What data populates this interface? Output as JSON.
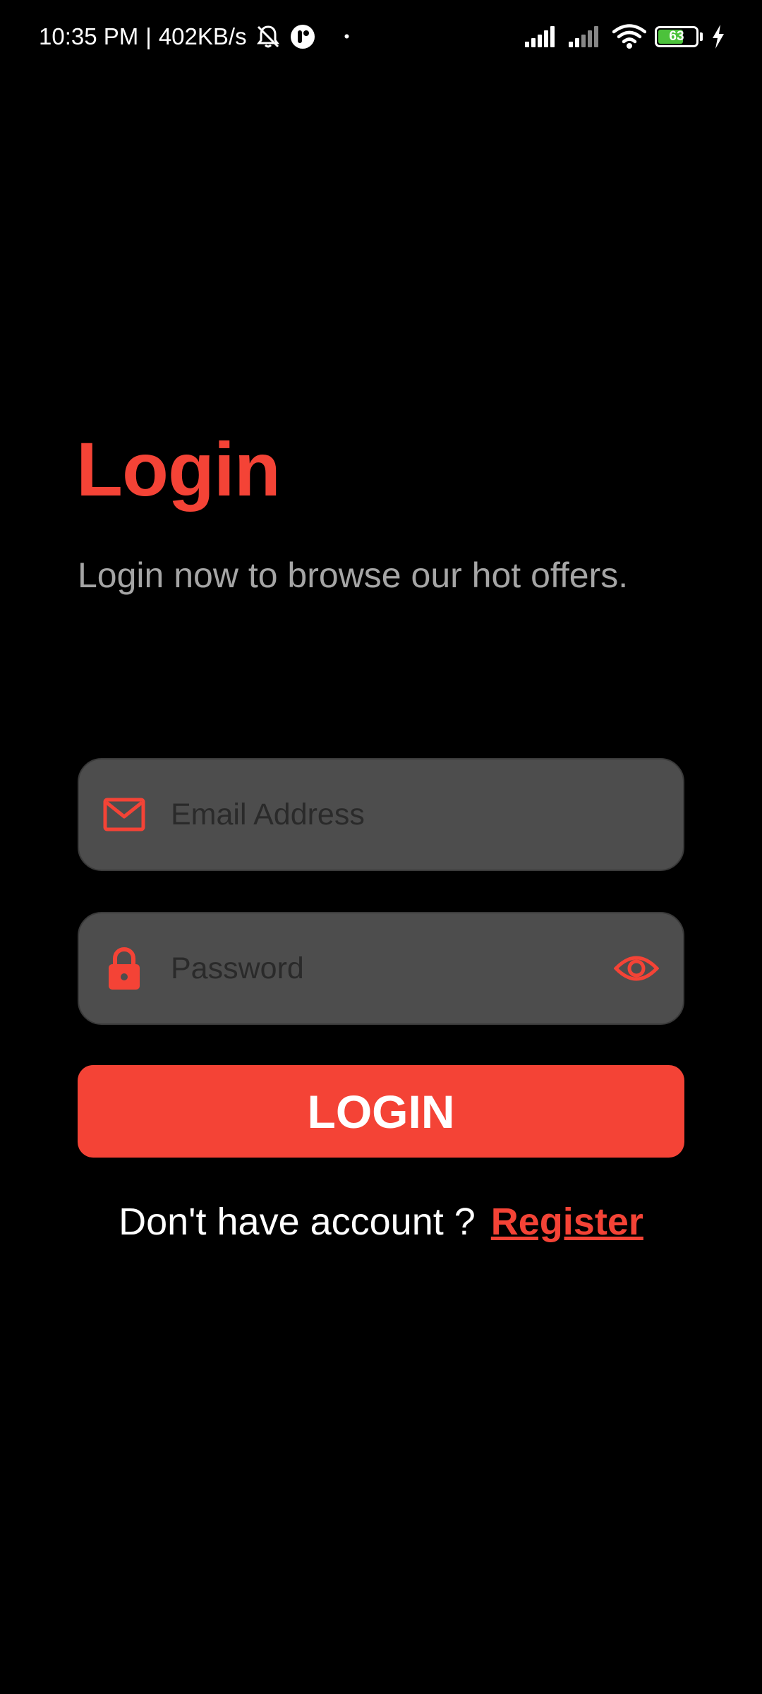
{
  "status_bar": {
    "time": "10:35 PM",
    "separator": "|",
    "net_speed": "402KB/s",
    "dot": "•",
    "battery_level": "63",
    "icons": [
      "mute-notifications-icon",
      "app-notification-icon",
      "signal-icon",
      "signal-icon",
      "wifi-icon",
      "battery-icon",
      "charging-icon"
    ],
    "battery_color": "#4cc23b"
  },
  "login": {
    "title": "Login",
    "subtitle": "Login now to browse our hot offers.",
    "email_placeholder": "Email Address",
    "password_placeholder": "Password",
    "button_label": "LOGIN",
    "register_prompt": "Don't have account ?",
    "register_link": "Register"
  },
  "colors": {
    "accent": "#f44336",
    "background": "#000000",
    "field_background": "#4d4d4d",
    "subtitle": "#a5a5a5"
  }
}
